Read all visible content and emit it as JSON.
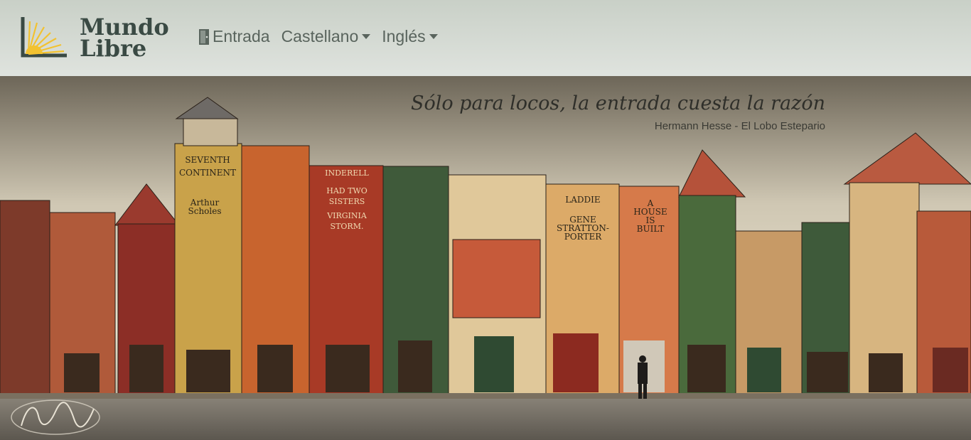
{
  "brand": {
    "line1": "Mundo",
    "line2": "Libre",
    "logo_icon": "sunrise-book-icon"
  },
  "nav": {
    "entrada": {
      "label": "Entrada",
      "icon": "door-icon"
    },
    "castellano": {
      "label": "Castellano",
      "icon": "caret-down-icon"
    },
    "ingles": {
      "label": "Inglés",
      "icon": "caret-down-icon"
    }
  },
  "hero": {
    "quote": "Sólo para locos, la entrada cuesta la razón",
    "author": "Hermann Hesse - El Lobo Estepario"
  },
  "colors": {
    "navbar": "#d5dad3",
    "brand": "#3a4a44",
    "nav_text": "#59645d",
    "logo_yellow": "#f2c230"
  }
}
